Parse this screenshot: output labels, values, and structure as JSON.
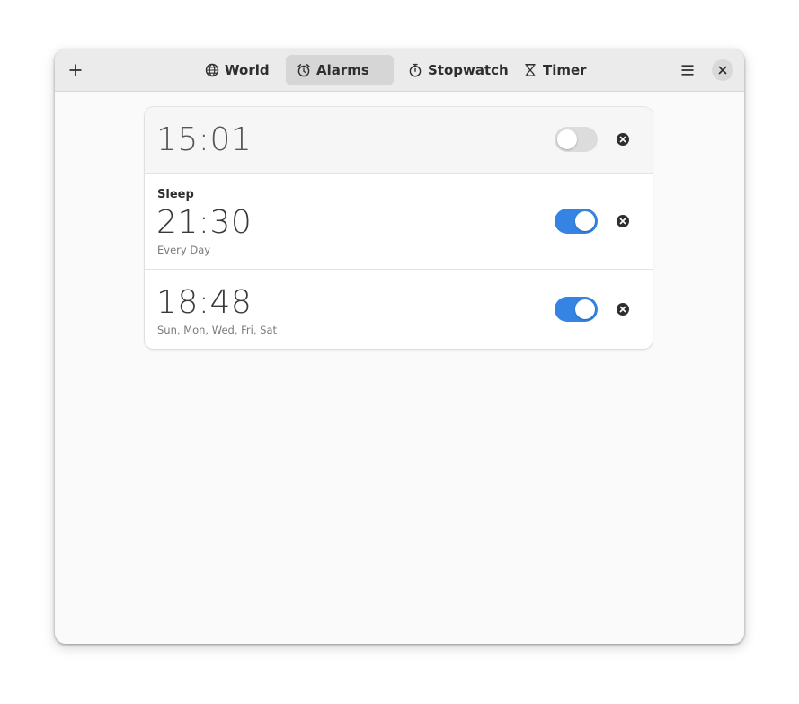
{
  "header": {
    "add_icon": "plus-icon",
    "menu_icon": "hamburger-menu-icon",
    "close_icon": "close-icon",
    "tabs": [
      {
        "label": "World",
        "icon": "globe-icon",
        "active": false
      },
      {
        "label": "Alarms",
        "icon": "alarm-clock-icon",
        "active": true
      },
      {
        "label": "Stopwatch",
        "icon": "stopwatch-icon",
        "active": false
      },
      {
        "label": "Timer",
        "icon": "hourglass-icon",
        "active": false
      }
    ]
  },
  "alarms": [
    {
      "name": "",
      "time": "15:01",
      "days": "",
      "enabled": false
    },
    {
      "name": "Sleep",
      "time": "21:30",
      "days": "Every Day",
      "enabled": true
    },
    {
      "name": "",
      "time": "18:48",
      "days": "Sun, Mon, Wed, Fri, Sat",
      "enabled": true
    }
  ],
  "colors": {
    "accent": "#3584e4",
    "toggle_off": "#dcdcdc",
    "headerbar": "#ebebeb"
  }
}
